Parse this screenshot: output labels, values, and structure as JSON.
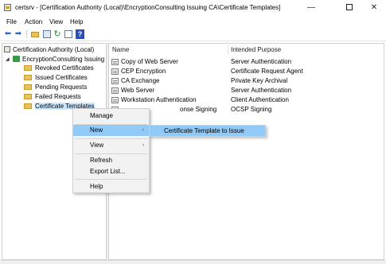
{
  "window": {
    "title": "certsrv - [Certification Authority (Local)\\EncryptionConsulting Issuing CA\\Certificate Templates]",
    "minimize_glyph": "—",
    "close_glyph": "✕"
  },
  "menubar": {
    "items": [
      {
        "label": "File"
      },
      {
        "label": "Action"
      },
      {
        "label": "View"
      },
      {
        "label": "Help"
      }
    ]
  },
  "toolbar": {
    "icons": [
      "back-arrow-icon",
      "forward-arrow-icon",
      "folder-up-icon",
      "show-hide-tree-icon",
      "refresh-icon",
      "export-list-icon",
      "help-icon"
    ],
    "back_glyph": "⬅",
    "forward_glyph": "➡",
    "refresh_glyph": "↻",
    "help_glyph": "?"
  },
  "tree": {
    "root": "Certification Authority (Local)",
    "server": "EncryptionConsulting Issuing",
    "expander_glyph": "◢",
    "folders": [
      {
        "label": "Revoked Certificates",
        "selected": false
      },
      {
        "label": "Issued Certificates",
        "selected": false
      },
      {
        "label": "Pending Requests",
        "selected": false
      },
      {
        "label": "Failed Requests",
        "selected": false
      },
      {
        "label": "Certificate Templates",
        "selected": true
      }
    ]
  },
  "list": {
    "columns": {
      "name": "Name",
      "purpose": "Intended Purpose"
    },
    "rows": [
      {
        "name": "Copy of Web Server",
        "purpose": "Server Authentication"
      },
      {
        "name": "CEP Encryption",
        "purpose": "Certificate Request Agent"
      },
      {
        "name": "CA Exchange",
        "purpose": "Private Key Archival"
      },
      {
        "name": "Web Server",
        "purpose": "Server Authentication"
      },
      {
        "name": "Workstation Authentication",
        "purpose": "Client Authentication"
      },
      {
        "name": "onse Signing",
        "purpose": "OCSP Signing"
      }
    ]
  },
  "context_menu": {
    "items": [
      {
        "label": "Manage",
        "highlighted": false,
        "submenu": false
      },
      {
        "label": "New",
        "highlighted": true,
        "submenu": true
      },
      {
        "label": "View",
        "highlighted": false,
        "submenu": true
      },
      {
        "label": "Refresh",
        "highlighted": false,
        "submenu": false
      },
      {
        "label": "Export List...",
        "highlighted": false,
        "submenu": false
      },
      {
        "label": "Help",
        "highlighted": false,
        "submenu": false
      }
    ],
    "submenu_arrow_glyph": "›"
  },
  "submenu": {
    "item": "Certificate Template to Issue"
  },
  "colors": {
    "highlight": "#91c9f7",
    "tree_selection": "#cce8ff",
    "menu_bg": "#f2f2f2"
  }
}
